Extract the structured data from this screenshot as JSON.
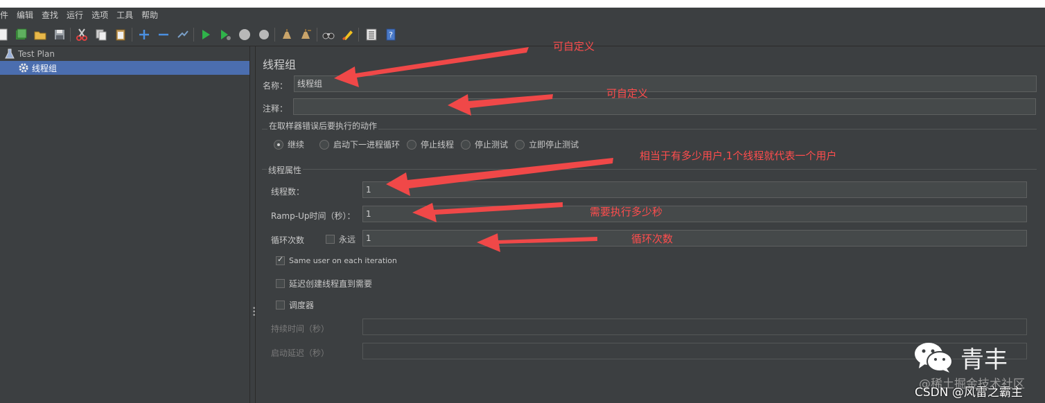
{
  "menu": [
    "件",
    "编辑",
    "查找",
    "运行",
    "选项",
    "工具",
    "帮助"
  ],
  "toolbar_icons": [
    "new-icon",
    "templates-icon",
    "open-icon",
    "save-icon",
    "cut-icon",
    "copy-icon",
    "paste-icon",
    "expand-icon",
    "collapse-icon",
    "toggle-icon",
    "start-icon",
    "start-no-pause-icon",
    "stop-icon",
    "shutdown-icon",
    "clear-icon",
    "clear-all-icon",
    "search-icon",
    "reset-search-icon",
    "function-helper-icon",
    "help-icon"
  ],
  "tree": {
    "root_label": "Test Plan",
    "child_label": "线程组"
  },
  "form": {
    "title": "线程组",
    "name_label": "名称：",
    "name_value": "线程组",
    "comment_label": "注释：",
    "comment_value": "",
    "sampler_error_title": "在取样器错误后要执行的动作",
    "error_options": [
      {
        "label": "继续",
        "selected": true
      },
      {
        "label": "启动下一进程循环",
        "selected": false
      },
      {
        "label": "停止线程",
        "selected": false
      },
      {
        "label": "停止测试",
        "selected": false
      },
      {
        "label": "立即停止测试",
        "selected": false
      }
    ],
    "thread_props_title": "线程属性",
    "threads_label": "线程数：",
    "threads_value": "1",
    "rampup_label": "Ramp-Up时间（秒）：",
    "rampup_value": "1",
    "loop_label": "循环次数",
    "forever_label": "永远",
    "forever_checked": false,
    "loop_value": "1",
    "same_user_label": "Same user on each iteration",
    "same_user_checked": true,
    "delay_label": "延迟创建线程直到需要",
    "delay_checked": false,
    "scheduler_label": "调度器",
    "scheduler_checked": false,
    "duration_label": "持续时间（秒）",
    "duration_value": "",
    "startup_delay_label": "启动延迟（秒）",
    "startup_delay_value": ""
  },
  "annotations": {
    "name": "可自定义",
    "comment": "可自定义",
    "threads": "相当于有多少用户,1个线程就代表一个用户",
    "rampup": "需要执行多少秒",
    "loop": "循环次数",
    "color": "#ff4d4d"
  },
  "watermark": {
    "wechat_name": "青丰",
    "juejin": "@稀土掘金技术社区",
    "csdn": "CSDN @风雷之霸主"
  },
  "colors": {
    "background": "#3c3f41",
    "selection": "#4b6eaf",
    "field": "#45494a"
  }
}
